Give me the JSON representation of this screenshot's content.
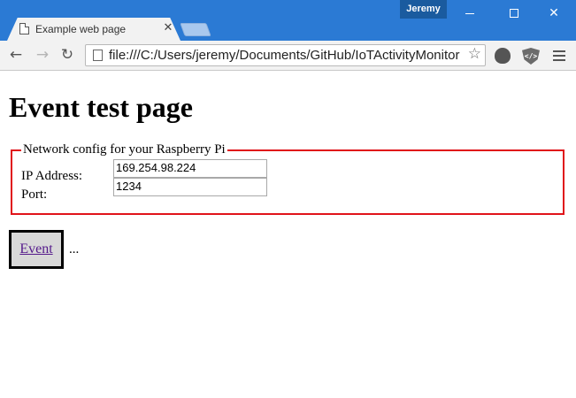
{
  "window": {
    "profile_name": "Jeremy",
    "titlebar_color": "#2b7ad4"
  },
  "tab": {
    "title": "Example web page",
    "close_glyph": "✕"
  },
  "toolbar": {
    "back_glyph": "←",
    "forward_glyph": "→",
    "reload_glyph": "↻",
    "url": "file:///C:/Users/jeremy/Documents/GitHub/IoTActivityMonitor",
    "star_glyph": "☆",
    "extension_icons": [
      "ghostery-icon",
      "user-agent-switcher-icon"
    ],
    "devtools_ext_label": "</>"
  },
  "page": {
    "heading": "Event test page",
    "network_config": {
      "legend": "Network config for your Raspberry Pi",
      "border_color": "#e0131a",
      "ip_label": "IP Address:",
      "ip_value": "169.254.98.224",
      "port_label": "Port:",
      "port_value": "1234"
    },
    "event_button_label": "Event",
    "event_status": "..."
  }
}
